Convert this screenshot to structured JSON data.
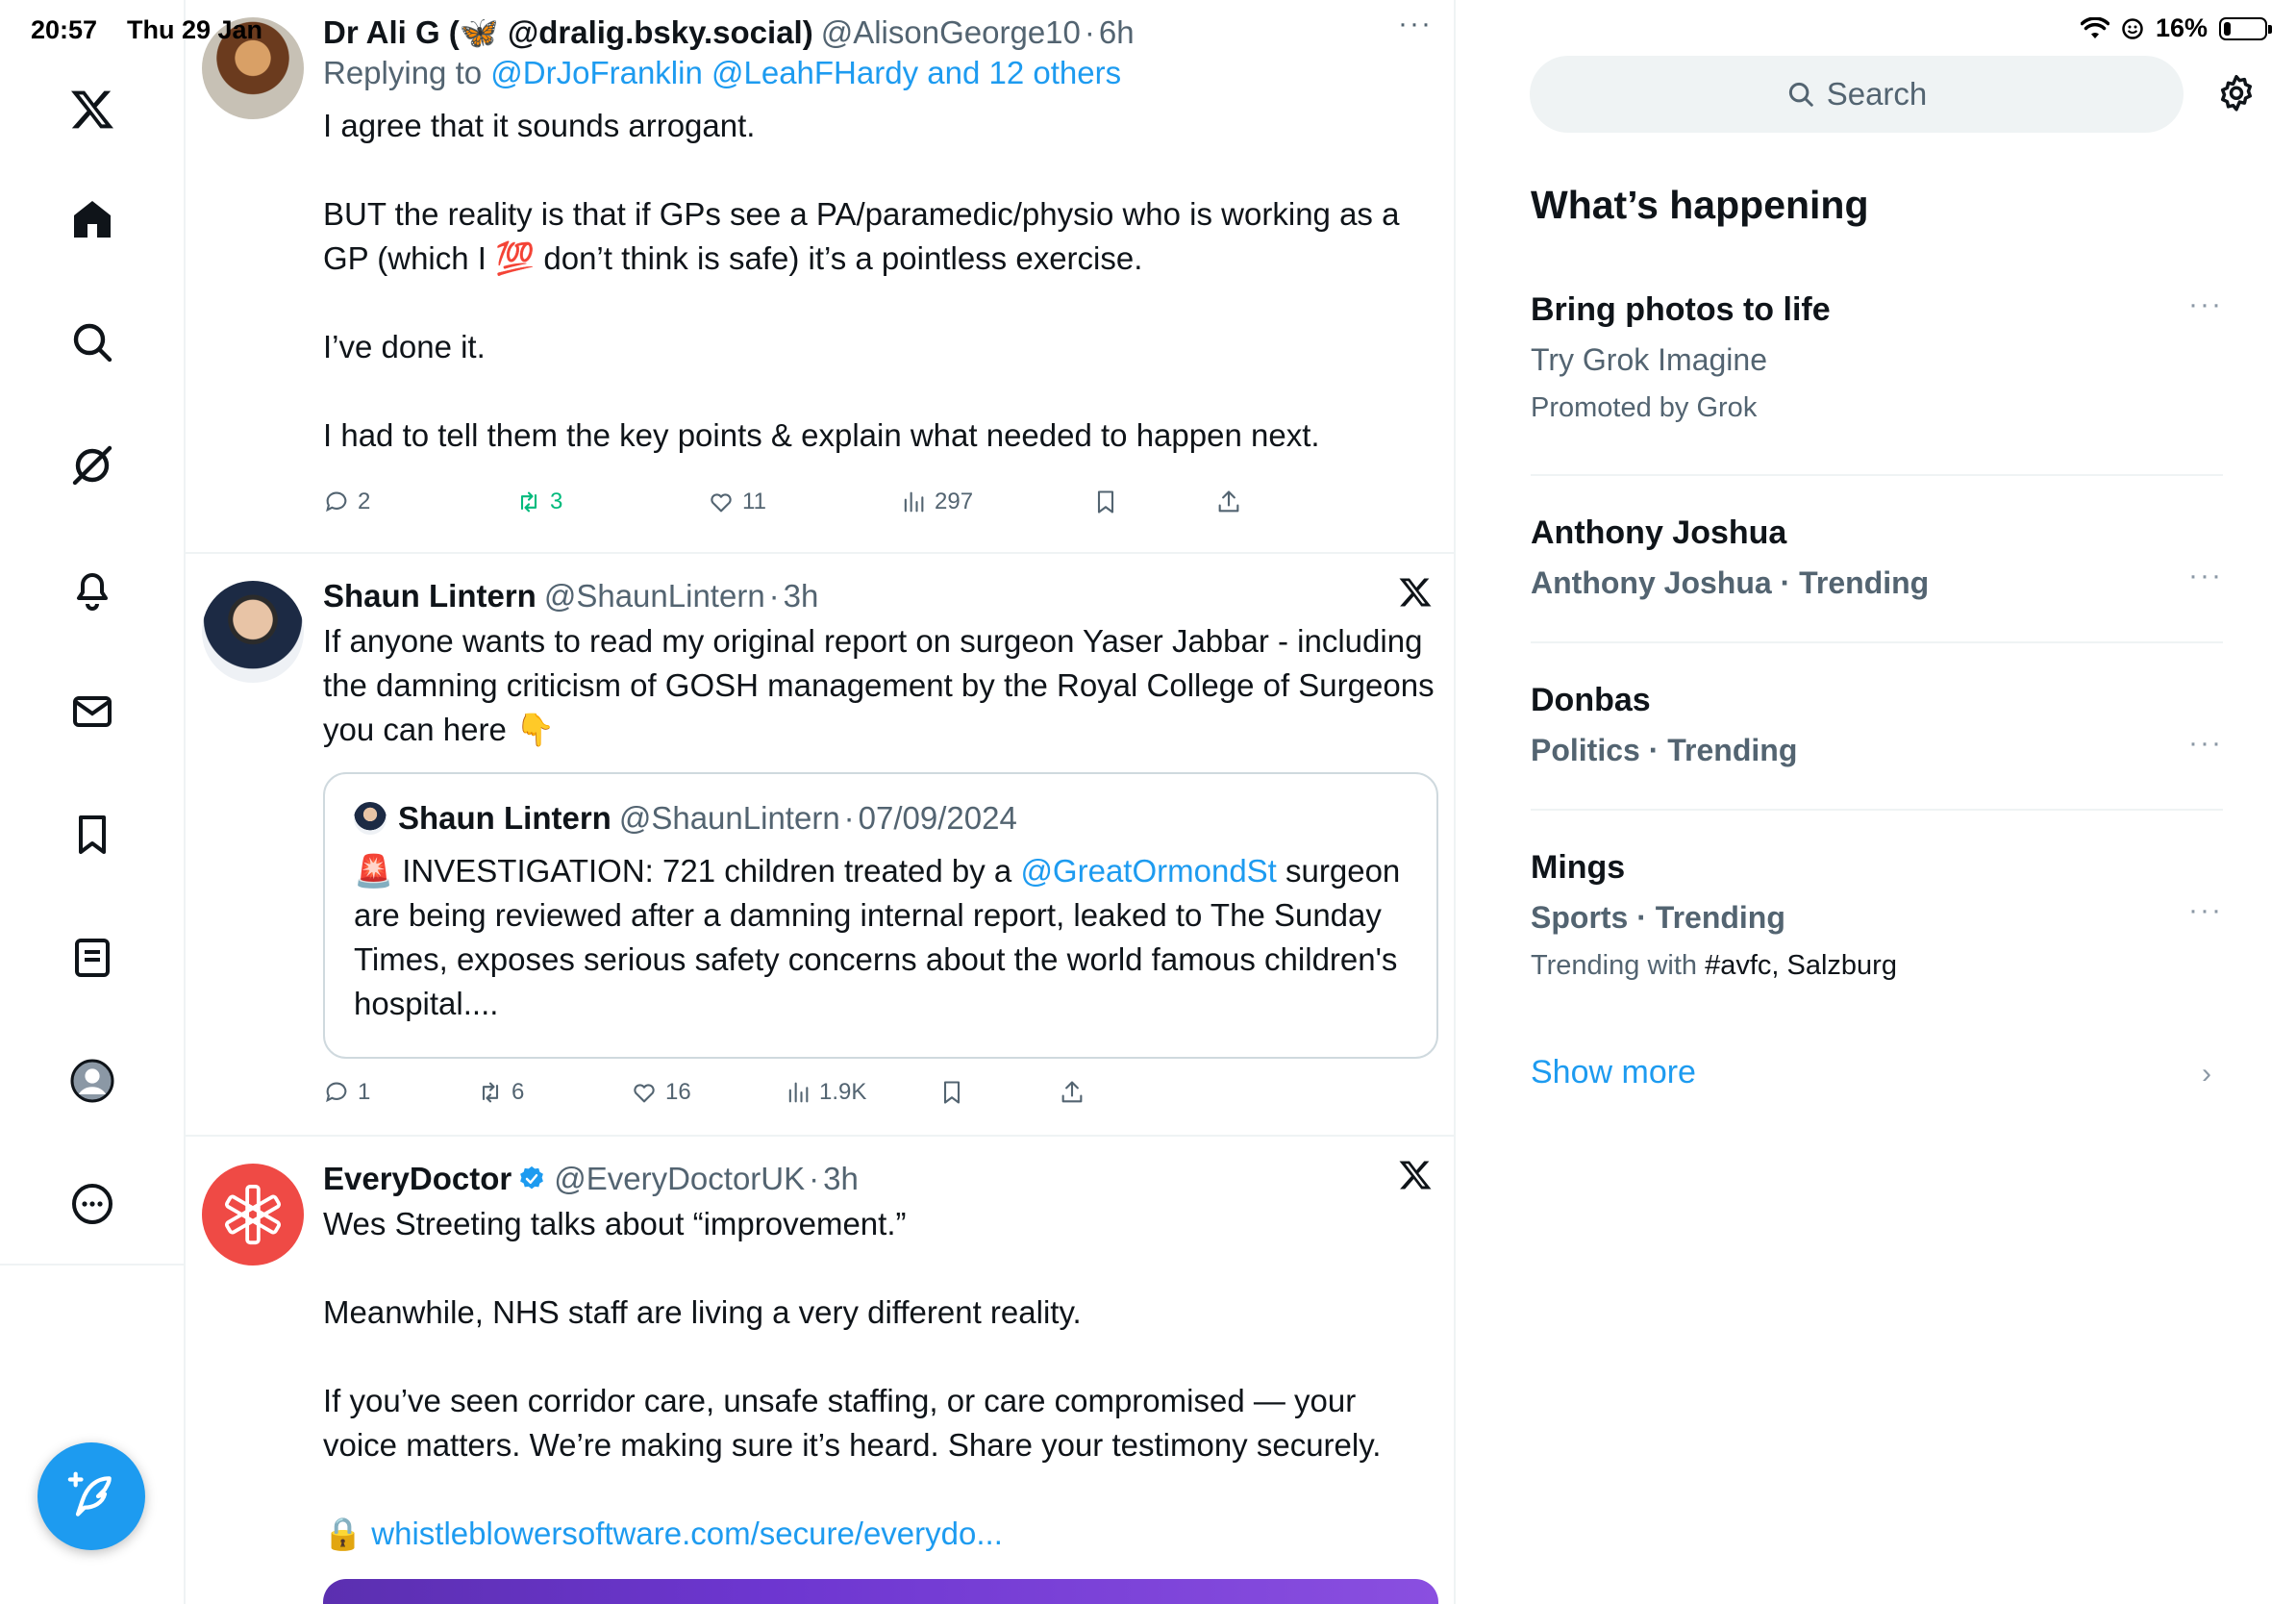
{
  "status_bar": {
    "time": "20:57",
    "date": "Thu 29 Jan",
    "battery": "16%",
    "battery_level": 0.16
  },
  "nav": {
    "items": [
      "x-logo",
      "home-icon",
      "search-icon",
      "grok-icon",
      "notifications-icon",
      "messages-icon",
      "bookmarks-icon",
      "lists-icon",
      "profile-icon",
      "more-icon"
    ],
    "compose_icon": "compose-icon"
  },
  "tweets": [
    {
      "name": "Dr Ali G (🦋 @dralig.bsky.social)",
      "handle": "@AlisonGeorge10",
      "time": "6h",
      "replying_prefix": "Replying to",
      "replying_mentions": "@DrJoFranklin @LeahFHardy and 12 others",
      "paragraphs": [
        "I agree that it sounds arrogant.",
        "BUT the reality is that if GPs see a PA/paramedic/physio who is working as a GP (which I 💯 don’t think is safe) it’s a pointless exercise.",
        "I’ve done it.",
        "I had to tell them the key points & explain what needed to happen next."
      ],
      "replies": "2",
      "reposts": "3",
      "likes": "11",
      "views": "297"
    },
    {
      "name": "Shaun Lintern",
      "handle": "@ShaunLintern",
      "time": "3h",
      "text": "If anyone wants to read my original report on surgeon Yaser Jabbar - including the damning criticism of GOSH management by the Royal College of Surgeons you can here 👇",
      "quote": {
        "name": "Shaun Lintern",
        "handle": "@ShaunLintern",
        "date": "07/09/2024",
        "text_start": "🚨 INVESTIGATION: 721 children treated by a",
        "mention": "@GreatOrmondSt",
        "text_end": "surgeon are being reviewed after a damning internal report, leaked to The Sunday Times, exposes serious safety concerns about the world famous children's hospital...."
      },
      "replies": "1",
      "reposts": "6",
      "likes": "16",
      "views": "1.9K"
    },
    {
      "name": "EveryDoctor",
      "handle": "@EveryDoctorUK",
      "time": "3h",
      "paragraphs": [
        "Wes Streeting talks about “improvement.”",
        "Meanwhile, NHS staff are living a very different reality.",
        "If you’ve seen corridor care, unsafe staffing, or care compromised — your voice matters. We’re making sure it’s heard. Share your testimony securely."
      ],
      "link_emoji": "🔒",
      "link": "whistleblowersoftware.com/secure/everydo..."
    }
  ],
  "sidebar": {
    "search_placeholder": "Search",
    "title": "What’s happening",
    "trends": [
      {
        "title": "Bring photos to life",
        "subtitle": "Try Grok Imagine",
        "meta": "Promoted by Grok"
      },
      {
        "title": "Anthony Joshua",
        "subtitle": "Anthony Joshua · Trending"
      },
      {
        "title": "Donbas",
        "subtitle": "Politics · Trending"
      },
      {
        "title": "Mings",
        "subtitle": "Sports · Trending",
        "meta_prefix": "Trending with",
        "meta_tags": "#avfc, Salzburg"
      }
    ],
    "show_more": "Show more"
  },
  "colors": {
    "accent": "#1d9bf0",
    "repost_active": "#00ba7c",
    "muted": "#536471"
  }
}
